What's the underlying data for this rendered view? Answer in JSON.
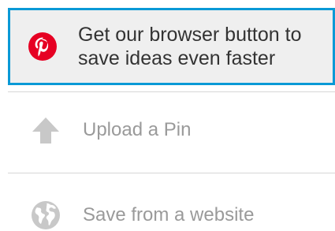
{
  "menu": {
    "items": [
      {
        "icon": "pinterest-logo-icon",
        "label_line1": "Get our browser button to",
        "label_line2": "save ideas even faster",
        "selected": true
      },
      {
        "icon": "upload-arrow-icon",
        "label": "Upload a Pin"
      },
      {
        "icon": "globe-icon",
        "label": "Save from a website"
      }
    ]
  },
  "colors": {
    "pinterest_red": "#e60023",
    "selection_border": "#0a99d6",
    "selection_bg": "#efefef",
    "muted_text": "#9a9a9a",
    "icon_gray": "#c8c8c8"
  }
}
